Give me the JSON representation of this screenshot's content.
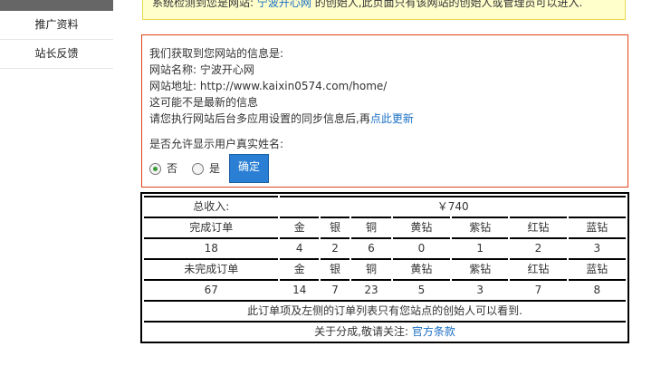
{
  "sidebar": {
    "items": [
      "推广资料",
      "站长反馈"
    ]
  },
  "notice": {
    "prefix": "系统检测到您是网站: ",
    "site": "宁波开心网",
    "suffix": " 的创始人,此页面只有该网站的创始人或管理员可以进入."
  },
  "info": {
    "heading": "我们获取到您网站的信息是:",
    "name": "网站名称: 宁波开心网",
    "url": "网站地址: http://www.kaixin0574.com/home/",
    "stale": "这可能不是最新的信息",
    "sync_text": "请您执行网站后台多应用设置的同步信息后,再",
    "sync_link": "点此更新",
    "question": "是否允许显示用户真实姓名:",
    "opt_no": "否",
    "opt_yes": "是",
    "confirm": "确定"
  },
  "stats": {
    "total_label": "总收入:",
    "total_value": "￥740",
    "headers": [
      "金",
      "银",
      "铜",
      "黄钻",
      "紫钻",
      "红钻",
      "蓝钻"
    ],
    "done_label": "完成订单",
    "done_total": "18",
    "done": [
      "4",
      "2",
      "6",
      "0",
      "1",
      "2",
      "3"
    ],
    "undone_label": "未完成订单",
    "undone_total": "67",
    "undone": [
      "14",
      "7",
      "23",
      "5",
      "3",
      "7",
      "8"
    ],
    "warning": "此订单项及左侧的订单列表只有您站点的创始人可以看到.",
    "footer_text": "关于分成,敬请关注: ",
    "footer_link": "官方条款"
  },
  "colors": {
    "accent": "#2a7fd4",
    "warning": "#e00000",
    "border": "#e04418"
  }
}
